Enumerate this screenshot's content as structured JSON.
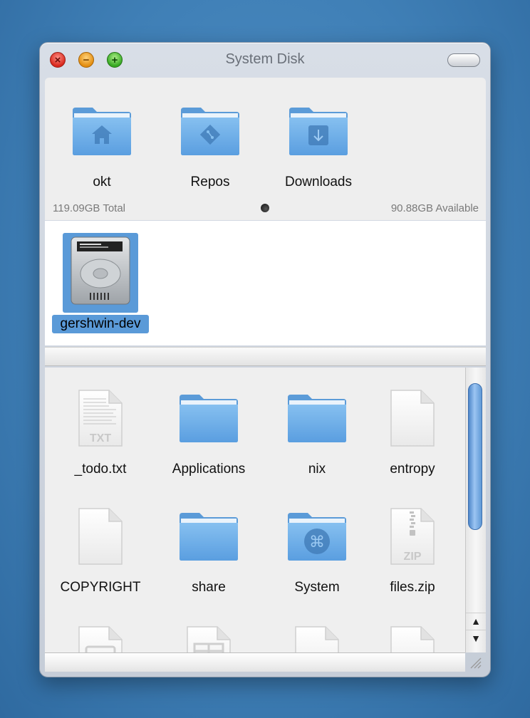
{
  "window": {
    "title": "System Disk",
    "controls": {
      "close": "×",
      "minimize": "−",
      "zoom": "+"
    }
  },
  "places": [
    {
      "label": "okt",
      "icon": "home-folder-icon"
    },
    {
      "label": "Repos",
      "icon": "git-folder-icon"
    },
    {
      "label": "Downloads",
      "icon": "downloads-folder-icon"
    }
  ],
  "disk_info": {
    "total": "119.09GB Total",
    "available": "90.88GB Available"
  },
  "device": {
    "label": "gershwin-dev",
    "icon": "hard-drive-icon"
  },
  "files": [
    {
      "label": "_todo.txt",
      "icon": "text-file-icon",
      "badge": "TXT"
    },
    {
      "label": "Applications",
      "icon": "folder-icon"
    },
    {
      "label": "nix",
      "icon": "folder-icon"
    },
    {
      "label": "entropy",
      "icon": "file-icon"
    },
    {
      "label": "COPYRIGHT",
      "icon": "file-icon"
    },
    {
      "label": "share",
      "icon": "folder-icon"
    },
    {
      "label": "System",
      "icon": "system-folder-icon"
    },
    {
      "label": "files.zip",
      "icon": "zip-file-icon",
      "badge": "ZIP"
    }
  ],
  "scrollbar": {
    "up": "▲",
    "down": "▼"
  },
  "colors": {
    "selection": "#5a9ad8",
    "folder": "#6aaee6",
    "desktop": "#3f7fb6"
  }
}
